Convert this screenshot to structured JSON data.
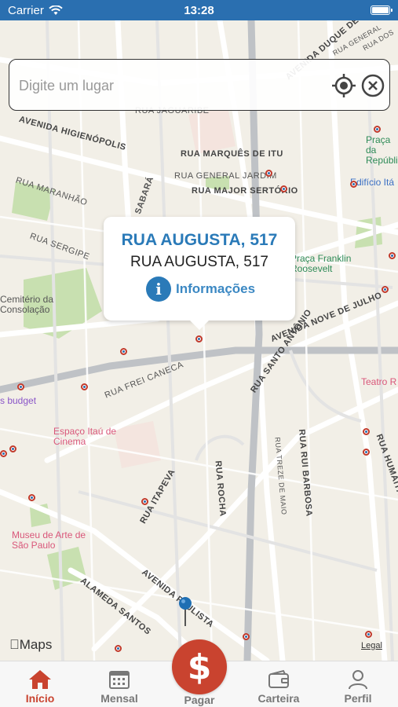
{
  "status_bar": {
    "carrier": "Carrier",
    "time": "13:28"
  },
  "search": {
    "placeholder": "Digite um lugar"
  },
  "popup": {
    "title": "RUA AUGUSTA, 517",
    "subtitle": "RUA AUGUSTA, 517",
    "info_label": "Informações"
  },
  "map": {
    "attribution": "Maps",
    "legal": "Legal",
    "labels": [
      "AVENIDA HIGIENÓPOLIS",
      "RUA MARANHÃO",
      "RUA SERGIPE",
      "RUA SABARÁ",
      "RUA MARQUÊS DE ITU",
      "RUA GENERAL JARDIM",
      "RUA MAJOR SERTÓRIO",
      "RUA JAGUARIBE",
      "AVENIDA NOVE DE JULHO",
      "RUA SANTO ANTÔNIO",
      "RUA FREI CANECA",
      "RUA RUI BARBOSA",
      "RUA TREZE DE MAIO",
      "RUA ROCHA",
      "RUA ITAPEVA",
      "ALAMEDA SANTOS",
      "AVENIDA PAULISTA",
      "RUA HUMAITÁ",
      "AVENIDA DUQUE DE",
      "RUA GENERAL",
      "RUA DOS"
    ],
    "pois": [
      "Cemitério da Consolação",
      "Praça da República",
      "Edifício Itá",
      "Praça Franklin Roosevelt",
      "Teatro R",
      "s budget",
      "Espaço Itaú de Cinema",
      "Museu de Arte de São Paulo"
    ]
  },
  "tabs": [
    {
      "label": "Início",
      "icon": "home-icon",
      "active": true
    },
    {
      "label": "Mensal",
      "icon": "calendar-icon",
      "active": false
    },
    {
      "label": "Pagar",
      "icon": "dollar-icon",
      "active": false
    },
    {
      "label": "Carteira",
      "icon": "wallet-icon",
      "active": false
    },
    {
      "label": "Perfil",
      "icon": "user-icon",
      "active": false
    }
  ],
  "colors": {
    "accent": "#c9432f",
    "status_bar": "#2a6fb0",
    "link": "#2a7ab8"
  }
}
